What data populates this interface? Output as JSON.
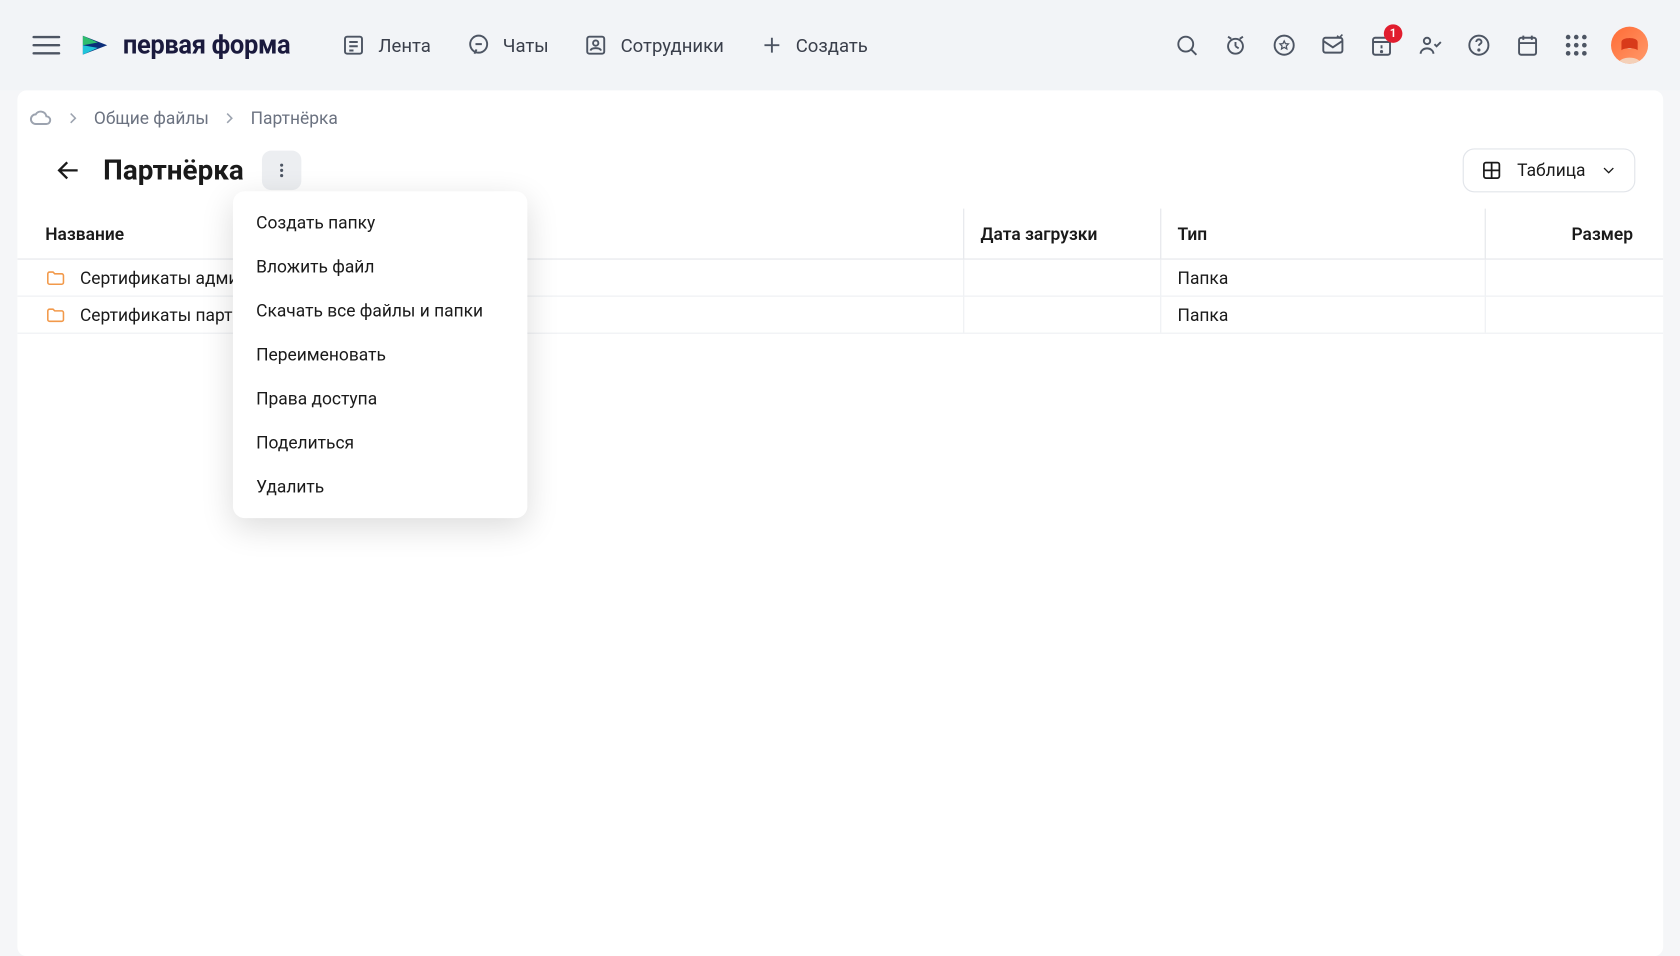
{
  "header": {
    "logo_text": "первая форма",
    "nav": {
      "feed": "Лента",
      "chats": "Чаты",
      "employees": "Сотрудники",
      "create": "Создать"
    },
    "badge_count": "1"
  },
  "breadcrumb": {
    "root": "Общие файлы",
    "current": "Партнёрка"
  },
  "page": {
    "title": "Партнёрка",
    "view_label": "Таблица"
  },
  "columns": {
    "name": "Название",
    "date": "Дата загрузки",
    "type": "Тип",
    "size": "Размер"
  },
  "rows": [
    {
      "name": "Сертификаты админов",
      "date": "",
      "type": "Папка",
      "size": ""
    },
    {
      "name": "Сертификаты партнёров",
      "date": "",
      "type": "Папка",
      "size": ""
    }
  ],
  "menu": {
    "create_folder": "Создать папку",
    "attach_file": "Вложить файл",
    "download_all": "Скачать все файлы и папки",
    "rename": "Переименовать",
    "permissions": "Права доступа",
    "share": "Поделиться",
    "delete": "Удалить"
  }
}
